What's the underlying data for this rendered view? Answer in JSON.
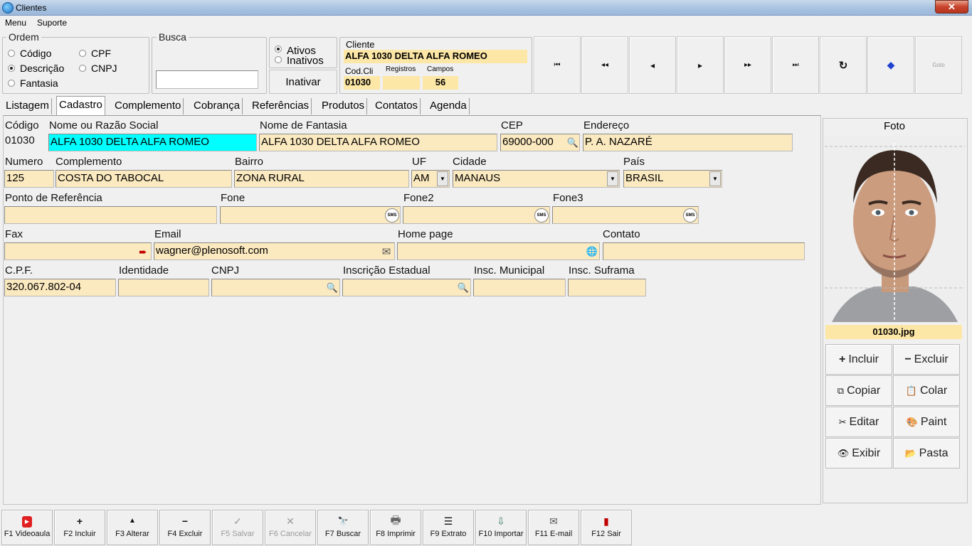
{
  "window": {
    "title": "Clientes",
    "close_glyph": "✕"
  },
  "menu": [
    "Menu",
    "Suporte"
  ],
  "ordem": {
    "legend": "Ordem",
    "options": [
      "Código",
      "CPF",
      "Descrição",
      "CNPJ",
      "Fantasia"
    ],
    "selected": "Descrição"
  },
  "busca": {
    "legend": "Busca",
    "value": ""
  },
  "status": {
    "options": [
      "Ativos",
      "Inativos"
    ],
    "selected": "Ativos",
    "inativar_label": "Inativar"
  },
  "cliente_box": {
    "cliente_label": "Cliente",
    "cliente_name": "ALFA 1030 DELTA ALFA ROMEO",
    "codcli_label": "Cod.Cli",
    "codcli_value": "01030",
    "registros_label": "Registros",
    "registros_value": "",
    "campos_label": "Campos",
    "campos_value": "56"
  },
  "nav_buttons": [
    {
      "name": "first-record-button",
      "icon": "first-icon",
      "glyph": "⏮"
    },
    {
      "name": "prev-page-button",
      "icon": "rewind-icon",
      "glyph": "◂◂"
    },
    {
      "name": "prev-record-button",
      "icon": "prev-icon",
      "glyph": "◂"
    },
    {
      "name": "next-record-button",
      "icon": "next-icon",
      "glyph": "▸"
    },
    {
      "name": "next-page-button",
      "icon": "fast-forward-icon",
      "glyph": "▸▸"
    },
    {
      "name": "last-record-button",
      "icon": "last-icon",
      "glyph": "⏭"
    },
    {
      "name": "refresh-button",
      "icon": "refresh-icon",
      "glyph": "↻"
    },
    {
      "name": "tag-button",
      "icon": "tag-icon",
      "glyph": "◆"
    },
    {
      "name": "goto-button",
      "icon": "goto-icon",
      "glyph": "Goto"
    }
  ],
  "tabs": [
    "Listagem",
    "Cadastro",
    "Complemento",
    "Cobrança",
    "Referências",
    "Produtos",
    "Contatos",
    "Agenda"
  ],
  "active_tab": "Cadastro",
  "form": {
    "codigo": {
      "label": "Código",
      "value": "01030"
    },
    "nome": {
      "label": "Nome ou Razão Social",
      "value": "ALFA 1030 DELTA ALFA ROMEO"
    },
    "fantasia": {
      "label": "Nome de Fantasia",
      "value": "ALFA 1030 DELTA ALFA ROMEO"
    },
    "cep": {
      "label": "CEP",
      "value": "69000-000"
    },
    "endereco": {
      "label": "Endereço",
      "value": "P. A. NAZARÉ"
    },
    "numero": {
      "label": "Numero",
      "value": "125"
    },
    "complemento": {
      "label": "Complemento",
      "value": "COSTA DO TABOCAL"
    },
    "bairro": {
      "label": "Bairro",
      "value": "ZONA RURAL"
    },
    "uf": {
      "label": "UF",
      "value": "AM"
    },
    "cidade": {
      "label": "Cidade",
      "value": "MANAUS"
    },
    "pais": {
      "label": "País",
      "value": "BRASIL"
    },
    "ponto_referencia": {
      "label": "Ponto de Referência",
      "value": ""
    },
    "fone": {
      "label": "Fone",
      "value": ""
    },
    "fone2": {
      "label": "Fone2",
      "value": ""
    },
    "fone3": {
      "label": "Fone3",
      "value": ""
    },
    "fax": {
      "label": "Fax",
      "value": ""
    },
    "email": {
      "label": "Email",
      "value": "wagner@plenosoft.com"
    },
    "homepage": {
      "label": "Home page",
      "value": ""
    },
    "contato": {
      "label": "Contato",
      "value": ""
    },
    "cpf": {
      "label": "C.P.F.",
      "value": "320.067.802-04"
    },
    "identidade": {
      "label": "Identidade",
      "value": ""
    },
    "cnpj": {
      "label": "CNPJ",
      "value": ""
    },
    "inscricao_estadual": {
      "label": "Inscrição Estadual",
      "value": ""
    },
    "insc_municipal": {
      "label": "Insc. Municipal",
      "value": ""
    },
    "insc_suframa": {
      "label": "Insc. Suframa",
      "value": ""
    },
    "sms_badge": "SMS"
  },
  "photo": {
    "title": "Foto",
    "filename": "01030.jpg",
    "buttons": [
      {
        "label": "Incluir",
        "icon": "plus-icon",
        "glyph": "+"
      },
      {
        "label": "Excluir",
        "icon": "minus-icon",
        "glyph": "−"
      },
      {
        "label": "Copiar",
        "icon": "copy-icon",
        "glyph": "⧉"
      },
      {
        "label": "Colar",
        "icon": "paste-icon",
        "glyph": "📋"
      },
      {
        "label": "Editar",
        "icon": "scissors-icon",
        "glyph": "✂"
      },
      {
        "label": "Paint",
        "icon": "palette-icon",
        "glyph": "🎨"
      },
      {
        "label": "Exibir",
        "icon": "eye-icon",
        "glyph": "👁"
      },
      {
        "label": "Pasta",
        "icon": "folder-icon",
        "glyph": "📂"
      }
    ]
  },
  "toolbar": [
    {
      "label": "F1 Videoaula",
      "icon": "youtube-icon",
      "glyph": "▶",
      "enabled": true
    },
    {
      "label": "F2 Incluir",
      "icon": "plus-icon",
      "glyph": "+",
      "enabled": true
    },
    {
      "label": "F3 Alterar",
      "icon": "up-arrow-icon",
      "glyph": "▲",
      "enabled": true
    },
    {
      "label": "F4 Excluir",
      "icon": "minus-icon",
      "glyph": "−",
      "enabled": true
    },
    {
      "label": "F5 Salvar",
      "icon": "check-icon",
      "glyph": "✓",
      "enabled": false
    },
    {
      "label": "F6 Cancelar",
      "icon": "x-icon",
      "glyph": "✕",
      "enabled": false
    },
    {
      "label": "F7 Buscar",
      "icon": "binoculars-icon",
      "glyph": "🔭",
      "enabled": true
    },
    {
      "label": "F8 Imprimir",
      "icon": "printer-icon",
      "glyph": "🖶",
      "enabled": true
    },
    {
      "label": "F9 Extrato",
      "icon": "list-icon",
      "glyph": "☰",
      "enabled": true
    },
    {
      "label": "F10 Importar",
      "icon": "import-icon",
      "glyph": "⇩",
      "enabled": true
    },
    {
      "label": "F11 E-mail",
      "icon": "mail-icon",
      "glyph": "✉",
      "enabled": true
    },
    {
      "label": "F12 Sair",
      "icon": "exit-icon",
      "glyph": "▮",
      "enabled": true
    }
  ],
  "colors": {
    "field_bg": "#fbe9bf",
    "highlight_field": "#00ffff",
    "cliente_bg": "#fde7a6",
    "youtube_red": "#e02020",
    "exit_red": "#c00000"
  }
}
